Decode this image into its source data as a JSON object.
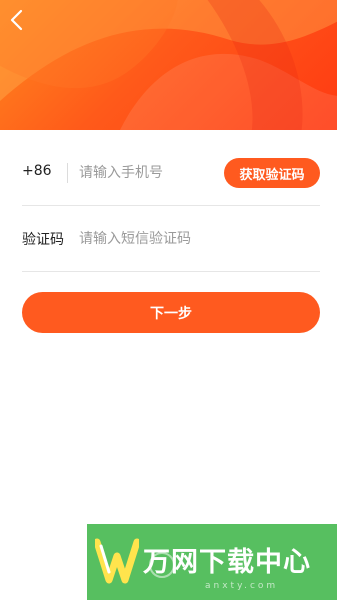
{
  "header": {
    "back_icon": "chevron-left-icon",
    "colors": {
      "start": "#ff8a1e",
      "end": "#ff3a12"
    }
  },
  "phone_row": {
    "country_code": "+86",
    "placeholder": "请输入手机号",
    "value": "",
    "get_code_label": "获取验证码"
  },
  "code_row": {
    "label": "验证码",
    "placeholder": "请输入短信验证码",
    "value": ""
  },
  "next_button": {
    "label": "下一步"
  },
  "watermark": {
    "logo_icon": "w-logo-icon",
    "text": "万网下载中心",
    "sub": "anxty.com"
  },
  "colors": {
    "accent": "#ff5a1f",
    "divider": "#e6e6e6",
    "placeholder": "#9a9a9a",
    "watermark": "#4aba54"
  }
}
